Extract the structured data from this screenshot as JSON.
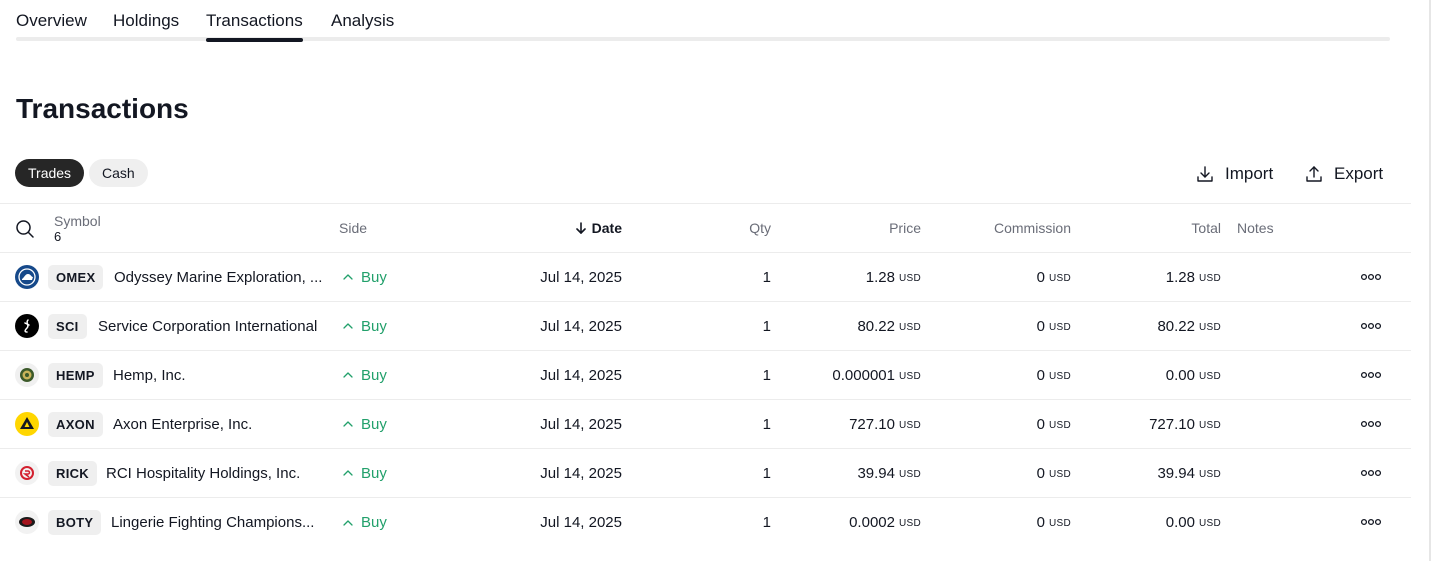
{
  "tabs": [
    {
      "label": "Overview",
      "active": false
    },
    {
      "label": "Holdings",
      "active": false
    },
    {
      "label": "Transactions",
      "active": true
    },
    {
      "label": "Analysis",
      "active": false
    }
  ],
  "page_title": "Transactions",
  "filters": {
    "trades": "Trades",
    "cash": "Cash",
    "selected": "Trades"
  },
  "actions": {
    "import_label": "Import",
    "export_label": "Export"
  },
  "table": {
    "headers": {
      "symbol": "Symbol",
      "symbol_count": "6",
      "side": "Side",
      "date": "Date",
      "qty": "Qty",
      "price": "Price",
      "commission": "Commission",
      "total": "Total",
      "notes": "Notes"
    },
    "sort": {
      "column": "Date",
      "direction": "descending",
      "icon": "arrow-down-icon"
    },
    "rows": [
      {
        "logo": "omex-logo",
        "logo_color": "#16498a",
        "ticker": "OMEX",
        "company": "Odyssey Marine Exploration, ...",
        "side": "Buy",
        "date": "Jul 14, 2025",
        "qty": "1",
        "price": "1.28",
        "price_cur": "USD",
        "commission": "0",
        "commission_cur": "USD",
        "total": "1.28",
        "total_cur": "USD"
      },
      {
        "logo": "sci-logo",
        "logo_color": "#000000",
        "ticker": "SCI",
        "company": "Service Corporation International",
        "side": "Buy",
        "date": "Jul 14, 2025",
        "qty": "1",
        "price": "80.22",
        "price_cur": "USD",
        "commission": "0",
        "commission_cur": "USD",
        "total": "80.22",
        "total_cur": "USD"
      },
      {
        "logo": "hemp-logo",
        "logo_color": "#3c5a2a",
        "ticker": "HEMP",
        "company": "Hemp, Inc.",
        "side": "Buy",
        "date": "Jul 14, 2025",
        "qty": "1",
        "price": "0.000001",
        "price_cur": "USD",
        "commission": "0",
        "commission_cur": "USD",
        "total": "0.00",
        "total_cur": "USD"
      },
      {
        "logo": "axon-logo",
        "logo_color": "#ffd600",
        "ticker": "AXON",
        "company": "Axon Enterprise, Inc.",
        "side": "Buy",
        "date": "Jul 14, 2025",
        "qty": "1",
        "price": "727.10",
        "price_cur": "USD",
        "commission": "0",
        "commission_cur": "USD",
        "total": "727.10",
        "total_cur": "USD"
      },
      {
        "logo": "rick-logo",
        "logo_color": "#d3202f",
        "ticker": "RICK",
        "company": "RCI Hospitality Holdings, Inc.",
        "side": "Buy",
        "date": "Jul 14, 2025",
        "qty": "1",
        "price": "39.94",
        "price_cur": "USD",
        "commission": "0",
        "commission_cur": "USD",
        "total": "39.94",
        "total_cur": "USD"
      },
      {
        "logo": "boty-logo",
        "logo_color": "#a3131c",
        "ticker": "BOTY",
        "company": "Lingerie Fighting Champions...",
        "side": "Buy",
        "date": "Jul 14, 2025",
        "qty": "1",
        "price": "0.0002",
        "price_cur": "USD",
        "commission": "0",
        "commission_cur": "USD",
        "total": "0.00",
        "total_cur": "USD"
      }
    ]
  },
  "colors": {
    "buy": "#22a06b",
    "active_pill": "#262626",
    "text": "#131722",
    "muted": "#6a6d78"
  }
}
